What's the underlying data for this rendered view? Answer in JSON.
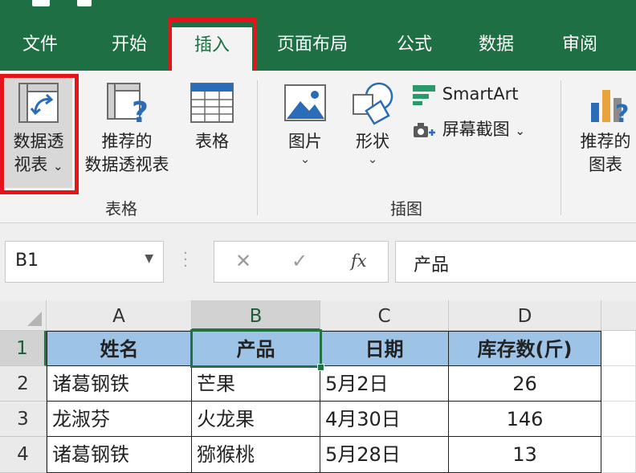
{
  "ribbon_tabs": [
    {
      "label": "文件"
    },
    {
      "label": "开始"
    },
    {
      "label": "插入",
      "active": true
    },
    {
      "label": "页面布局"
    },
    {
      "label": "公式"
    },
    {
      "label": "数据"
    },
    {
      "label": "审阅"
    }
  ],
  "groups": {
    "tables": {
      "label": "表格",
      "pivot_table": {
        "line1": "数据透",
        "line2": "视表",
        "chevron": "⌄",
        "icon": "pivot-table-icon"
      },
      "recommended_pivot": {
        "line1": "推荐的",
        "line2": "数据透视表",
        "icon": "recommended-pivot-icon"
      },
      "table": {
        "label": "表格",
        "icon": "table-icon"
      }
    },
    "illustrations": {
      "label": "插图",
      "pictures": {
        "label": "图片",
        "chevron": "⌄",
        "icon": "picture-icon"
      },
      "shapes": {
        "label": "形状",
        "chevron": "⌄",
        "icon": "shapes-icon"
      },
      "smartart": {
        "label": "SmartArt",
        "icon": "smartart-icon"
      },
      "screenshot": {
        "label": "屏幕截图",
        "chevron": "⌄",
        "icon": "screenshot-icon"
      }
    },
    "charts": {
      "recommended_charts": {
        "line1": "推荐的",
        "line2": "图表",
        "icon": "recommended-chart-icon"
      }
    }
  },
  "formula_bar": {
    "name_box": "B1",
    "cancel_glyph": "✕",
    "enter_glyph": "✓",
    "fx_glyph": "fx",
    "formula": "产品"
  },
  "sheet": {
    "columns": [
      "A",
      "B",
      "C",
      "D"
    ],
    "rows": [
      "1",
      "2",
      "3",
      "4"
    ],
    "selected_cell": "B1",
    "header": [
      "姓名",
      "产品",
      "日期",
      "库存数(斤)"
    ],
    "data": [
      [
        "诸葛钢铁",
        "芒果",
        "5月2日",
        "26"
      ],
      [
        "龙淑芬",
        "火龙果",
        "4月30日",
        "146"
      ],
      [
        "诸葛钢铁",
        "猕猴桃",
        "5月28日",
        "13"
      ]
    ]
  },
  "colors": {
    "ribbon_green": "#1e6f43",
    "header_fill": "#9dc3e6",
    "highlight_red": "#e5141b",
    "selection_green": "#217346"
  }
}
